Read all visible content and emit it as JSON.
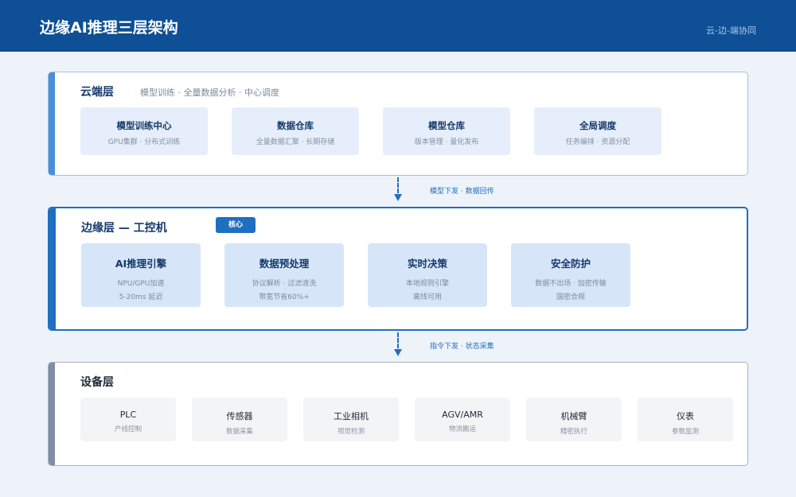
{
  "header": {
    "title": "边缘AI推理三层架构",
    "subtitle": "云-边-端协同"
  },
  "layers": {
    "cloud": {
      "title": "云端层",
      "description": "模型训练 · 全量数据分析 · 中心调度",
      "cards": [
        {
          "title": "模型训练中心",
          "desc": "GPU集群 · 分布式训练"
        },
        {
          "title": "数据仓库",
          "desc": "全量数据汇聚 · 长期存储"
        },
        {
          "title": "模型仓库",
          "desc": "版本管理 · 量化发布"
        },
        {
          "title": "全局调度",
          "desc": "任务编排 · 资源分配"
        }
      ]
    },
    "edge": {
      "title": "边缘层 — 工控机",
      "badge": "核心",
      "cards": [
        {
          "title": "AI推理引擎",
          "desc1": "NPU/GPU加速",
          "desc2": "5-20ms 延迟"
        },
        {
          "title": "数据预处理",
          "desc1": "协议解析 · 过滤清洗",
          "desc2": "带宽节省60%+"
        },
        {
          "title": "实时决策",
          "desc1": "本地规则引擎",
          "desc2": "离线可用"
        },
        {
          "title": "安全防护",
          "desc1": "数据不出场 · 加密传输",
          "desc2": "国密合规"
        }
      ]
    },
    "device": {
      "title": "设备层",
      "cards": [
        {
          "title": "PLC",
          "desc": "产线控制"
        },
        {
          "title": "传感器",
          "desc": "数据采集"
        },
        {
          "title": "工业相机",
          "desc": "视觉检测"
        },
        {
          "title": "AGV/AMR",
          "desc": "物流搬运"
        },
        {
          "title": "机械臂",
          "desc": "精密执行"
        },
        {
          "title": "仪表",
          "desc": "参数监测"
        }
      ]
    }
  },
  "connectors": {
    "cloud_edge": "模型下发 · 数据回传",
    "edge_device": "指令下发 · 状态采集"
  },
  "colors": {
    "header": "#0e4f95",
    "accent": "#1f6fc0",
    "cloud_stripe": "#4a8fd6",
    "device_stripe": "#7e8fa3"
  }
}
